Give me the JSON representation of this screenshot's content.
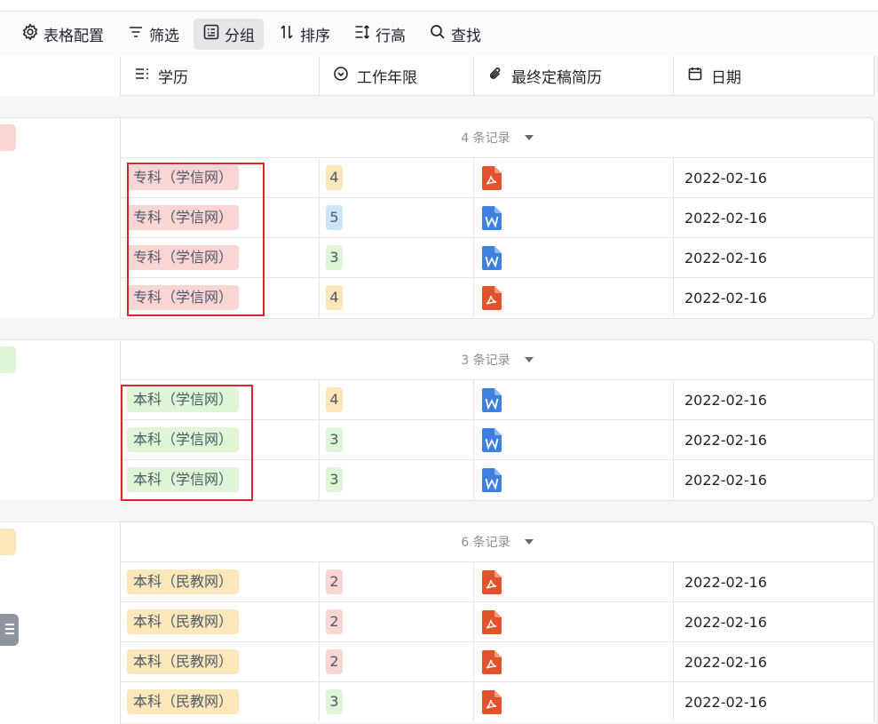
{
  "toolbar": {
    "items": [
      {
        "label": "表格配置",
        "icon": "gear-icon"
      },
      {
        "label": "筛选",
        "icon": "filter-icon"
      },
      {
        "label": "分组",
        "icon": "group-icon",
        "active": true
      },
      {
        "label": "排序",
        "icon": "sort-icon"
      },
      {
        "label": "行高",
        "icon": "row-height-icon"
      },
      {
        "label": "查找",
        "icon": "search-icon"
      }
    ]
  },
  "columns": [
    {
      "label": "学历",
      "icon": "single-select-icon"
    },
    {
      "label": "工作年限",
      "icon": "dropdown-circle-icon"
    },
    {
      "label": "最终定稿简历",
      "icon": "attachment-icon"
    },
    {
      "label": "日期",
      "icon": "calendar-icon"
    }
  ],
  "groups": [
    {
      "count_label": "4 条记录",
      "rows": [
        {
          "edu": "专科（学信网）",
          "years": "4",
          "file": "pdf",
          "date": "2022-02-16"
        },
        {
          "edu": "专科（学信网）",
          "years": "5",
          "file": "word",
          "date": "2022-02-16"
        },
        {
          "edu": "专科（学信网）",
          "years": "3",
          "file": "word",
          "date": "2022-02-16"
        },
        {
          "edu": "专科（学信网）",
          "years": "4",
          "file": "pdf",
          "date": "2022-02-16"
        }
      ]
    },
    {
      "count_label": "3 条记录",
      "rows": [
        {
          "edu": "本科（学信网）",
          "years": "4",
          "file": "word",
          "date": "2022-02-16"
        },
        {
          "edu": "本科（学信网）",
          "years": "3",
          "file": "word",
          "date": "2022-02-16"
        },
        {
          "edu": "本科（学信网）",
          "years": "3",
          "file": "word",
          "date": "2022-02-16"
        }
      ]
    },
    {
      "count_label": "6 条记录",
      "rows": [
        {
          "edu": "本科（民教网）",
          "years": "2",
          "file": "pdf",
          "date": "2022-02-16"
        },
        {
          "edu": "本科（民教网）",
          "years": "2",
          "file": "pdf",
          "date": "2022-02-16"
        },
        {
          "edu": "本科（民教网）",
          "years": "2",
          "file": "pdf",
          "date": "2022-02-16"
        },
        {
          "edu": "本科（民教网）",
          "years": "3",
          "file": "pdf",
          "date": "2022-02-16"
        }
      ]
    }
  ],
  "colors": {
    "pink_tag": "#fbd4d4",
    "green_tag": "#dff5d5",
    "yellow_tag": "#fbe7b9",
    "blue_tag": "#cbe6f7",
    "pdf_icon": "#e2532d",
    "word_icon": "#3f7fe0",
    "highlight_box": "#d9262c"
  }
}
